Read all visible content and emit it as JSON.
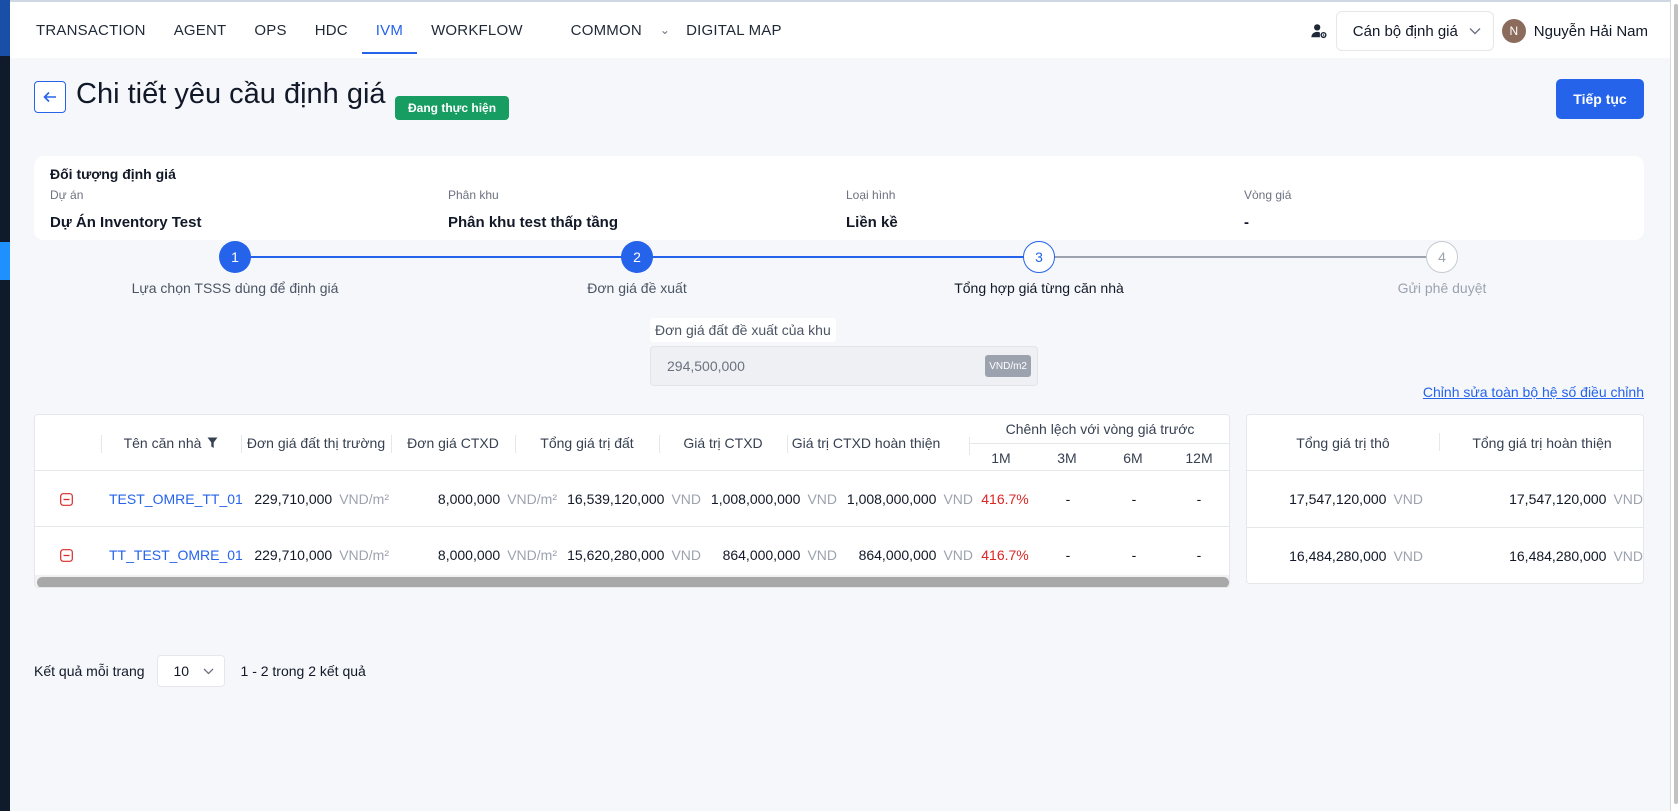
{
  "nav": {
    "items": [
      {
        "label": "TRANSACTION"
      },
      {
        "label": "AGENT"
      },
      {
        "label": "OPS"
      },
      {
        "label": "HDC"
      },
      {
        "label": "IVM",
        "active": true
      },
      {
        "label": "WORKFLOW"
      },
      {
        "label": "COMMON",
        "has_dropdown": true
      },
      {
        "label": "DIGITAL MAP"
      }
    ]
  },
  "header": {
    "role_select": "Cán bộ định giá",
    "avatar_initial": "N",
    "user_name": "Nguyễn Hải Nam"
  },
  "page": {
    "title": "Chi tiết yêu cầu định giá",
    "status": "Đang thực hiện",
    "continue_label": "Tiếp tục"
  },
  "subject": {
    "title": "Đối tượng định giá",
    "fields": [
      {
        "label": "Dự án",
        "value": "Dự Án Inventory Test"
      },
      {
        "label": "Phân khu",
        "value": "Phân khu test thấp tầng"
      },
      {
        "label": "Loại hình",
        "value": "Liền kề"
      },
      {
        "label": "Vòng giá",
        "value": "-"
      }
    ]
  },
  "steps": [
    {
      "number": "1",
      "label": "Lựa chọn TSSS dùng để định giá",
      "state": "done"
    },
    {
      "number": "2",
      "label": "Đơn giá đề xuất",
      "state": "done"
    },
    {
      "number": "3",
      "label": "Tổng hợp giá từng căn nhà",
      "state": "current"
    },
    {
      "number": "4",
      "label": "Gửi phê duyệt",
      "state": "todo"
    }
  ],
  "proposed_price": {
    "label": "Đơn giá đất đề xuất của khu",
    "value": "294,500,000",
    "unit": "VND/m2"
  },
  "edit_link": "Chỉnh sửa toàn bộ hệ số điều chỉnh",
  "table": {
    "columns": {
      "name": "Tên căn nhà",
      "land_market_price": "Đơn giá đất thị trường",
      "ctxd_price": "Đơn giá CTXD",
      "land_total": "Tổng giá trị đất",
      "ctxd_value": "Giá trị CTXD",
      "ctxd_finished": "Giá trị CTXD hoàn thiện",
      "diff_group": "Chênh lệch với vòng giá trước",
      "diff_1m": "1M",
      "diff_3m": "3M",
      "diff_6m": "6M",
      "diff_12m": "12M"
    },
    "units": {
      "per_m2": "VND/m²",
      "vnd": "VND"
    },
    "rows": [
      {
        "name": "TEST_OMRE_TT_01",
        "land_market_price": "229,710,000",
        "ctxd_price": "8,000,000",
        "land_total": "16,539,120,000",
        "ctxd_value": "1,008,000,000",
        "ctxd_finished": "1,008,000,000",
        "diff_1m": "416.7%",
        "diff_3m": "-",
        "diff_6m": "-",
        "diff_12m": "-"
      },
      {
        "name": "TT_TEST_OMRE_01",
        "land_market_price": "229,710,000",
        "ctxd_price": "8,000,000",
        "land_total": "15,620,280,000",
        "ctxd_value": "864,000,000",
        "ctxd_finished": "864,000,000",
        "diff_1m": "416.7%",
        "diff_3m": "-",
        "diff_6m": "-",
        "diff_12m": "-"
      }
    ]
  },
  "summary": {
    "columns": {
      "raw_total": "Tổng giá trị thô",
      "finished_total": "Tổng giá trị hoàn thiện"
    },
    "rows": [
      {
        "raw_total": "17,547,120,000",
        "finished_total": "17,547,120,000"
      },
      {
        "raw_total": "16,484,280,000",
        "finished_total": "16,484,280,000"
      }
    ]
  },
  "pagination": {
    "per_page_label": "Kết quả mỗi trang",
    "page_size": "10",
    "range_text": "1 - 2 trong 2 kết quả"
  },
  "colors": {
    "primary": "#2563eb",
    "status_badge": "#179c62",
    "negative": "#dc2626"
  }
}
